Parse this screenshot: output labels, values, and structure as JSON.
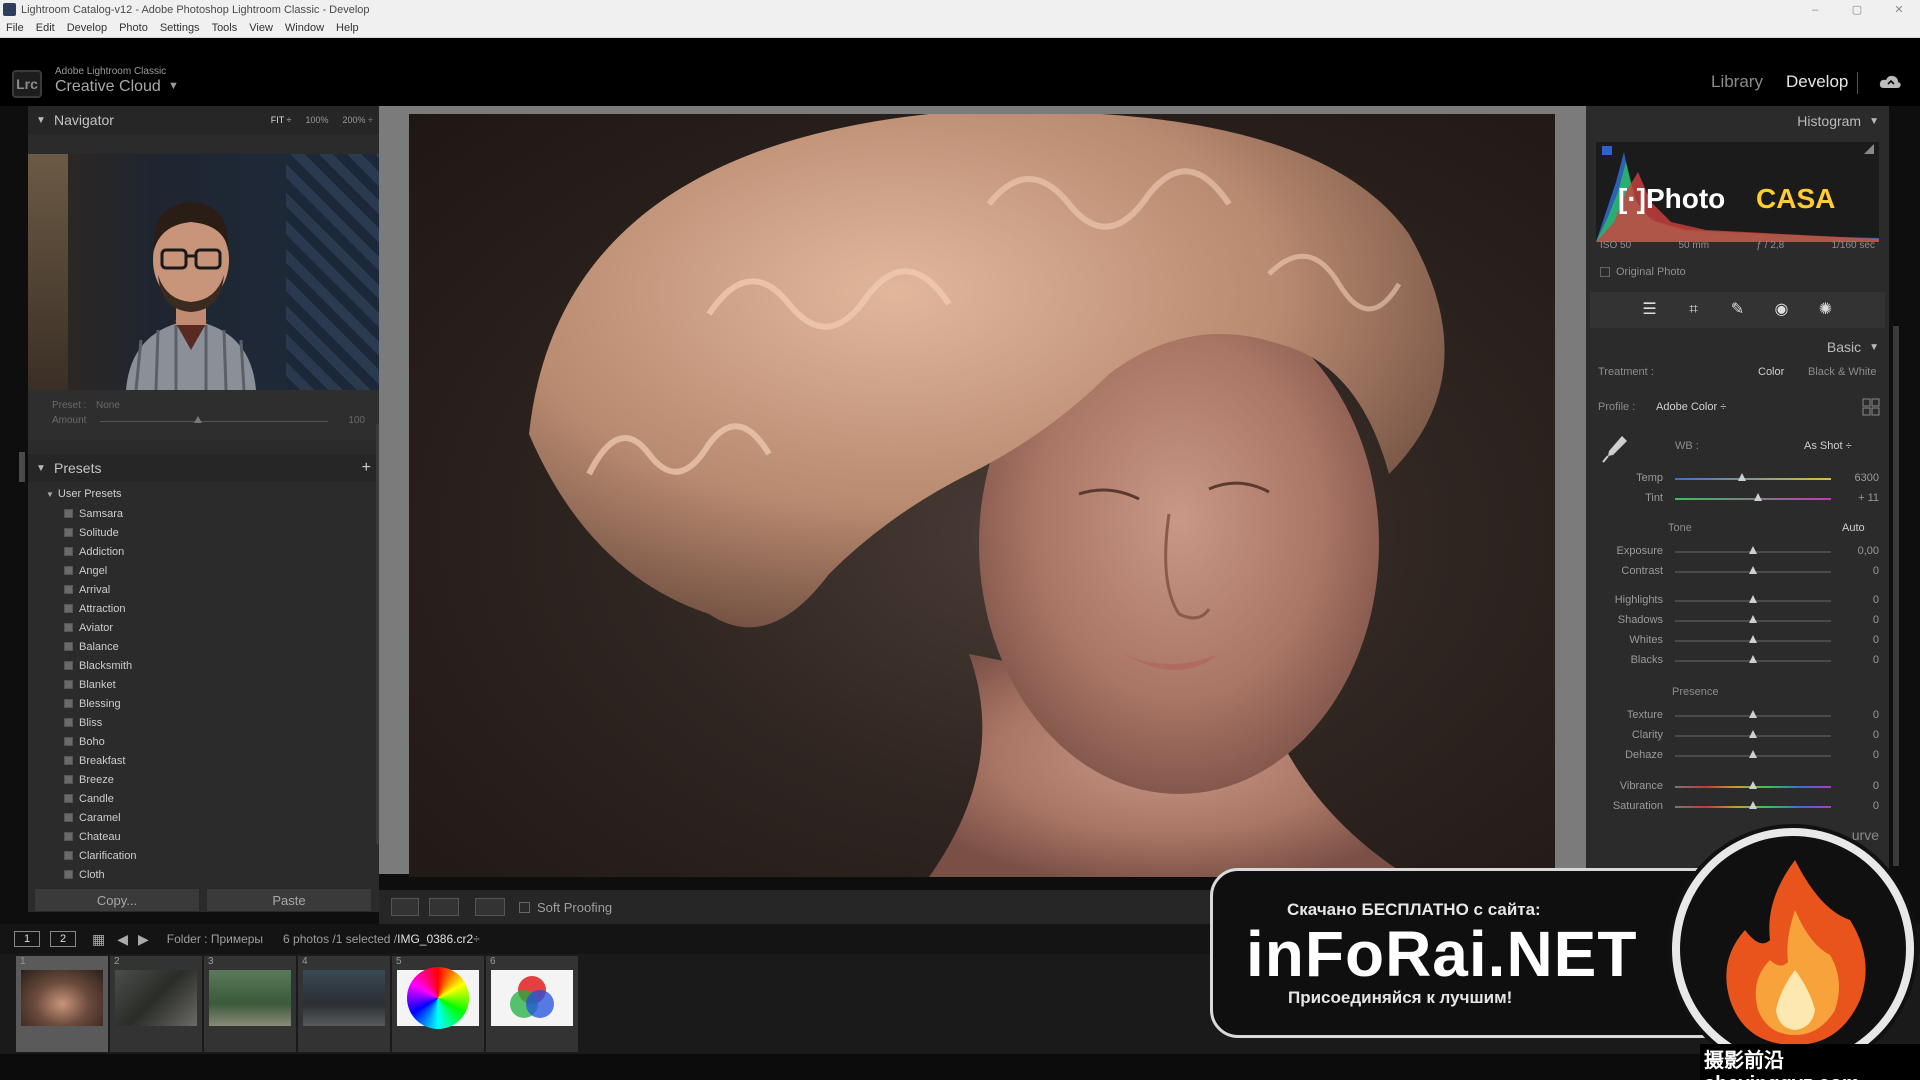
{
  "window": {
    "title": "Lightroom Catalog-v12 - Adobe Photoshop Lightroom Classic - Develop",
    "controls": [
      "–",
      "▢",
      "✕"
    ]
  },
  "menu": [
    "File",
    "Edit",
    "Develop",
    "Photo",
    "Settings",
    "Tools",
    "View",
    "Window",
    "Help"
  ],
  "header": {
    "badge": "Lrc",
    "brand_small": "Adobe Lightroom Classic",
    "brand_big": "Creative Cloud",
    "brand_caret": "▼",
    "modules": {
      "library": "Library",
      "develop": "Develop"
    },
    "active_module": "Develop"
  },
  "navigator": {
    "title": "Navigator",
    "zoom": [
      "FIT ÷",
      "100%",
      "200% ÷"
    ],
    "preset_label": "Preset :",
    "preset_value": "None",
    "amount_label": "Amount",
    "amount_value": "100",
    "amount_fraction": 0.43
  },
  "presets": {
    "title": "Presets",
    "add": "+",
    "group": "User Presets",
    "items": [
      "Samsara",
      "Solitude",
      "Addiction",
      "Angel",
      "Arrival",
      "Attraction",
      "Aviator",
      "Balance",
      "Blacksmith",
      "Blanket",
      "Blessing",
      "Bliss",
      "Boho",
      "Breakfast",
      "Breeze",
      "Candle",
      "Caramel",
      "Chateau",
      "Clarification",
      "Cloth"
    ]
  },
  "buttons": {
    "copy": "Copy...",
    "paste": "Paste"
  },
  "toolbar": {
    "soft_proofing": "Soft Proofing"
  },
  "histogram": {
    "title": "Histogram",
    "iso": "ISO 50",
    "focal": "50 mm",
    "aperture": "ƒ / 2,8",
    "shutter": "1/160 sec",
    "original_photo": "Original Photo",
    "overlay_logo_1": "[·]Photo",
    "overlay_logo_2": "CASA"
  },
  "basic": {
    "title": "Basic",
    "treatment_label": "Treatment :",
    "treatment_color": "Color",
    "treatment_bw": "Black & White",
    "profile_label": "Profile :",
    "profile_value": "Adobe Color ÷",
    "wb_label": "WB :",
    "wb_value": "As Shot ÷",
    "tone_label": "Tone",
    "auto_label": "Auto",
    "presence_label": "Presence",
    "sliders_wb": [
      {
        "label": "Temp",
        "value": "6300",
        "pos": 0.43
      },
      {
        "label": "Tint",
        "value": "+ 11",
        "pos": 0.53
      }
    ],
    "sliders_tone1": [
      {
        "label": "Exposure",
        "value": "0,00",
        "pos": 0.5
      },
      {
        "label": "Contrast",
        "value": "0",
        "pos": 0.5
      }
    ],
    "sliders_tone2": [
      {
        "label": "Highlights",
        "value": "0",
        "pos": 0.5
      },
      {
        "label": "Shadows",
        "value": "0",
        "pos": 0.5
      },
      {
        "label": "Whites",
        "value": "0",
        "pos": 0.5
      },
      {
        "label": "Blacks",
        "value": "0",
        "pos": 0.5
      }
    ],
    "sliders_presence1": [
      {
        "label": "Texture",
        "value": "0",
        "pos": 0.5
      },
      {
        "label": "Clarity",
        "value": "0",
        "pos": 0.5
      },
      {
        "label": "Dehaze",
        "value": "0",
        "pos": 0.5
      }
    ],
    "sliders_presence2": [
      {
        "label": "Vibrance",
        "value": "0",
        "pos": 0.5
      },
      {
        "label": "Saturation",
        "value": "0",
        "pos": 0.5
      }
    ],
    "next_panel": "urve"
  },
  "filmstrip": {
    "tabs": [
      "1",
      "2"
    ],
    "folder": "Folder : Примеры",
    "count": "6 photos /1 selected /",
    "filename": "IMG_0386.cr2",
    "filename_suffix": " ÷",
    "thumbs": [
      "1",
      "2",
      "3",
      "4",
      "5",
      "6"
    ]
  },
  "watermark": {
    "line1": "Скачано БЕСПЛАТНО с сайта:",
    "line2": "inFoRai.NET",
    "line3": "Присоединяйся к лучшим!",
    "corner": "摄影前沿sheyingqyz.com"
  },
  "colors": {
    "accent": "#e6e6e6",
    "panel": "#2b2b2b",
    "canvas": "#7b7b7b"
  }
}
